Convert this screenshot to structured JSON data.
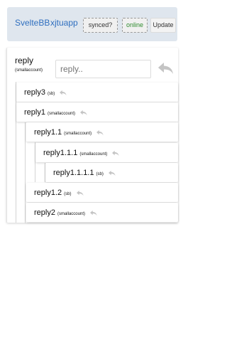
{
  "header": {
    "app_name": "SvelteBB",
    "username": "xjtuapp",
    "synced_label": "synced?",
    "online_label": "online",
    "update_label": "Update"
  },
  "root": {
    "title": "reply",
    "author": "(smallaccount)",
    "input_placeholder": "reply.."
  },
  "replies": [
    {
      "title": "reply3",
      "author": "(sb)"
    },
    {
      "title": "reply1",
      "author": "(smallaccount)"
    },
    {
      "title": "reply1.1",
      "author": "(smallaccount)"
    },
    {
      "title": "reply1.1.1",
      "author": "(smallaccount)"
    },
    {
      "title": "reply1.1.1.1",
      "author": "(sb)"
    },
    {
      "title": "reply1.2",
      "author": "(sb)"
    },
    {
      "title": "reply2",
      "author": "(smallaccount)"
    }
  ],
  "colors": {
    "link": "#2f6fbf",
    "online": "#2e8b2e",
    "reply_icon": "#c4c4c4"
  }
}
